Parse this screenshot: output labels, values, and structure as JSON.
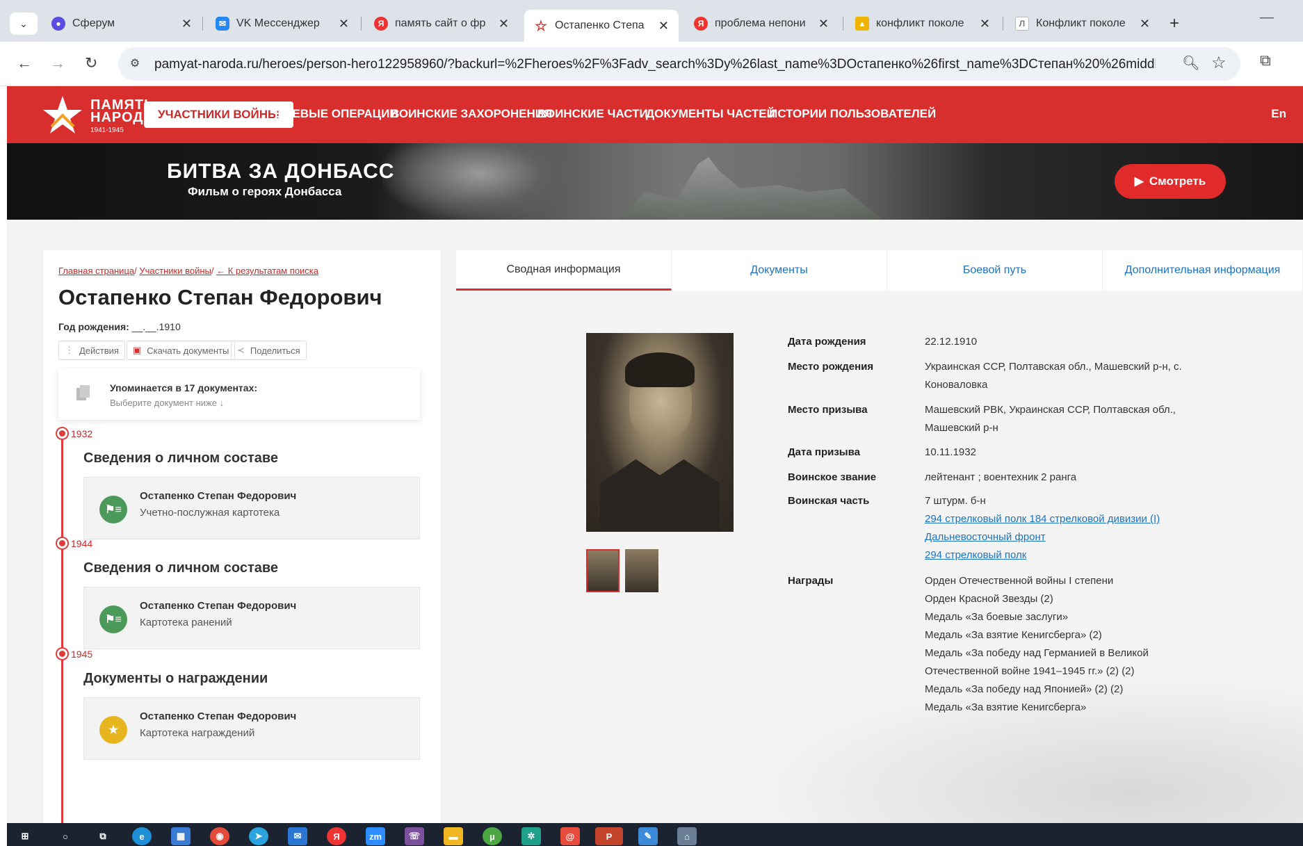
{
  "browser": {
    "tabs": [
      {
        "title": "Сферум",
        "icon": "sferum-icon",
        "color": "#5a4ce0"
      },
      {
        "title": "VK Мессенджер",
        "icon": "vk-icon",
        "color": "#2787f5"
      },
      {
        "title": "память сайт о фр",
        "icon": "yandex-icon",
        "color": "#e33"
      },
      {
        "title": "Остапенко Степа",
        "icon": "star-icon",
        "color": "#d82e2e"
      },
      {
        "title": "проблема непони",
        "icon": "yandex-icon",
        "color": "#e33"
      },
      {
        "title": "конфликт поколе",
        "icon": "image-icon",
        "color": "#f0b400"
      },
      {
        "title": "Конфликт поколе",
        "icon": "doc-icon",
        "color": "#777"
      }
    ],
    "url": "pamyat-naroda.ru/heroes/person-hero122958960/?backurl=%2Fheroes%2F%3Fadv_search%3Dy%26last_name%3DОстапенко%26first_name%3DСтепан%20%26middle_n..."
  },
  "site": {
    "logo_line1": "ПАМЯТЬ",
    "logo_line2": "НАРОДА",
    "logo_years": "1941-1945",
    "nav": [
      "УЧАСТНИКИ ВОЙНЫ",
      "БОЕВЫЕ ОПЕРАЦИИ",
      "ВОИНСКИЕ ЗАХОРОНЕНИЯ",
      "ВОИНСКИЕ ЧАСТИ",
      "ДОКУМЕНТЫ ЧАСТЕЙ",
      "ИСТОРИИ ПОЛЬЗОВАТЕЛЕЙ"
    ],
    "lang": "En",
    "accent": "#d82e2e"
  },
  "banner": {
    "title": "БИТВА ЗА ДОНБАСС",
    "subtitle": "Фильм о героях Донбасса",
    "button": "Смотреть"
  },
  "person": {
    "breadcrumbs": [
      "Главная страница",
      "Участники войны",
      "← К результатам поиска"
    ],
    "name": "Остапенко Степан Федорович",
    "birth_label": "Год рождения:",
    "birth_value": "__.__.1910",
    "actions": [
      "Действия",
      "Скачать документы",
      "Поделиться"
    ],
    "mention_title": "Упоминается в 17 документах:",
    "mention_sub": "Выберите документ ниже ↓"
  },
  "timeline": [
    {
      "year": "1932",
      "title": "Сведения о личном составе",
      "name": "Остапенко Степан Федорович",
      "desc": "Учетно-послужная картотека"
    },
    {
      "year": "1944",
      "title": "Сведения о личном составе",
      "name": "Остапенко Степан Федорович",
      "desc": "Картотека ранений"
    },
    {
      "year": "1945",
      "title": "Документы о награждении",
      "name": "Остапенко Степан Федорович",
      "desc": "Картотека награждений"
    }
  ],
  "tabs": [
    "Сводная информация",
    "Документы",
    "Боевой путь",
    "Дополнительная информация"
  ],
  "info": {
    "birth_date_label": "Дата рождения",
    "birth_date": "22.12.1910",
    "birth_place_label": "Место рождения",
    "birth_place": "Украинская ССР, Полтавская обл., Машевский р-н, с. Коноваловка",
    "draft_place_label": "Место призыва",
    "draft_place": "Машевский РВК, Украинская ССР, Полтавская обл., Машевский р-н",
    "draft_date_label": "Дата призыва",
    "draft_date": "10.11.1932",
    "rank_label": "Воинское звание",
    "rank": "лейтенант ; воентехник 2 ранга",
    "unit_label": "Воинская часть",
    "unit": "7 штурм. б-н",
    "unit_links": [
      "294 стрелковый полк 184 стрелковой дивизии (I)",
      "Дальневосточный фронт",
      "294 стрелковый полк"
    ],
    "awards_label": "Награды",
    "awards": [
      "Орден Отечественной войны I степени",
      "Орден Красной Звезды (2)",
      "Медаль «За боевые заслуги»",
      "Медаль «За взятие Кенигсберга» (2)",
      "Медаль «За победу над Германией в Великой Отечественной войне 1941–1945 гг.» (2) (2)",
      "Медаль «За победу над Японией» (2) (2)",
      "Медаль «За взятие Кенигсберга»"
    ]
  },
  "taskbar": [
    "windows-icon",
    "search-icon",
    "taskview-icon",
    "edge-icon",
    "store-icon",
    "chrome-icon",
    "telegram-icon",
    "mail-icon",
    "yandex-icon",
    "zoom-icon",
    "viber-icon",
    "files-icon",
    "utorrent-icon",
    "puzzle-icon",
    "mail2-icon",
    "powerpoint-icon",
    "paint-icon",
    "network-icon"
  ]
}
